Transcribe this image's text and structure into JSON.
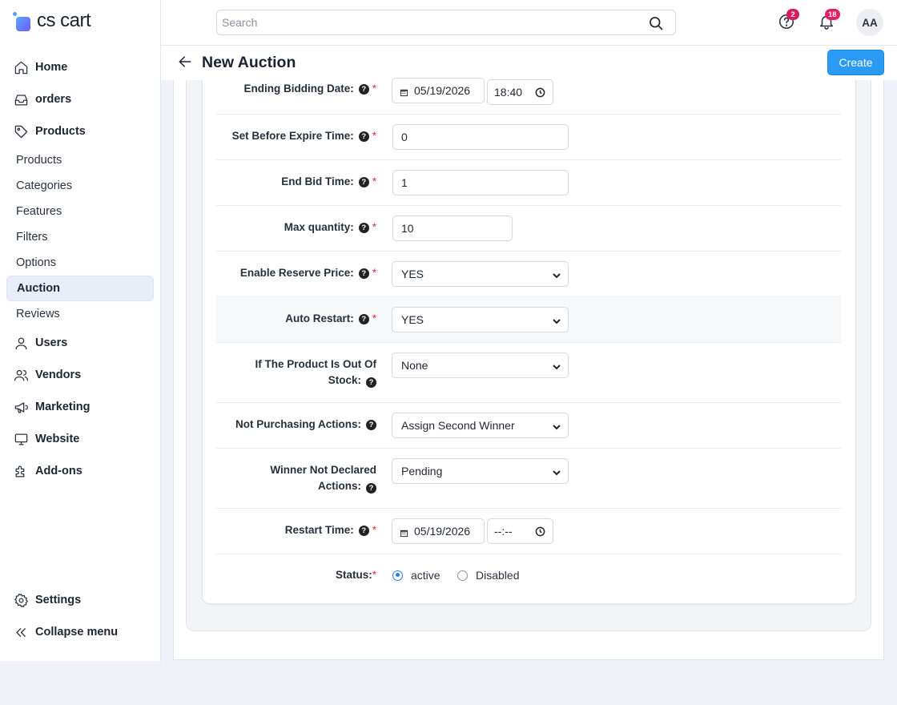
{
  "brand": {
    "name": "cs cart"
  },
  "sidebar": {
    "items": [
      {
        "label": "Home",
        "icon": "home-icon"
      },
      {
        "label": "orders",
        "icon": "inbox-icon"
      },
      {
        "label": "Products",
        "icon": "tag-icon"
      }
    ],
    "sub_items": [
      "Products",
      "Categories",
      "Features",
      "Filters",
      "Options",
      "Auction",
      "Reviews"
    ],
    "items_after": [
      {
        "label": "Users",
        "icon": "user-icon"
      },
      {
        "label": "Vendors",
        "icon": "users-icon"
      },
      {
        "label": "Marketing",
        "icon": "megaphone-icon"
      },
      {
        "label": "Website",
        "icon": "monitor-icon"
      },
      {
        "label": "Add-ons",
        "icon": "puzzle-icon"
      }
    ],
    "settings": "Settings",
    "collapse": "Collapse menu",
    "active_sub": "Auction"
  },
  "topbar": {
    "search_placeholder": "Search",
    "help_badge": "2",
    "notifications_badge": "18",
    "avatar_initials": "AA",
    "help_badge_color": "#d81b60",
    "notifications_badge_color": "#e91e63"
  },
  "header": {
    "title": "New Auction",
    "create_label": "Create",
    "accent": "#2b9af3"
  },
  "form": {
    "ending_bidding_date": {
      "label": "Ending Bidding Date:",
      "date": "05/19/2026",
      "time": "18:40"
    },
    "set_before_expire": {
      "label": "Set Before Expire Time:",
      "value": "0"
    },
    "end_bid_time": {
      "label": "End Bid Time:",
      "value": "1"
    },
    "max_quantity": {
      "label": "Max quantity:",
      "value": "10"
    },
    "enable_reserve_price": {
      "label": "Enable Reserve Price:",
      "value": "YES"
    },
    "auto_restart": {
      "label": "Auto Restart:",
      "value": "YES"
    },
    "out_of_stock": {
      "label_line1": "If The Product Is Out Of",
      "label_line2": "Stock:",
      "value": "None"
    },
    "not_purchasing": {
      "label": "Not Purchasing Actions:",
      "value": "Assign Second Winner"
    },
    "winner_not_declared": {
      "label_line1": "Winner Not Declared",
      "label_line2": "Actions:",
      "value": "Pending"
    },
    "restart_time": {
      "label": "Restart Time:",
      "date": "05/19/2026",
      "time": "--:--"
    },
    "status": {
      "label": "Status:",
      "options": [
        "active",
        "Disabled"
      ],
      "selected": "active"
    }
  }
}
